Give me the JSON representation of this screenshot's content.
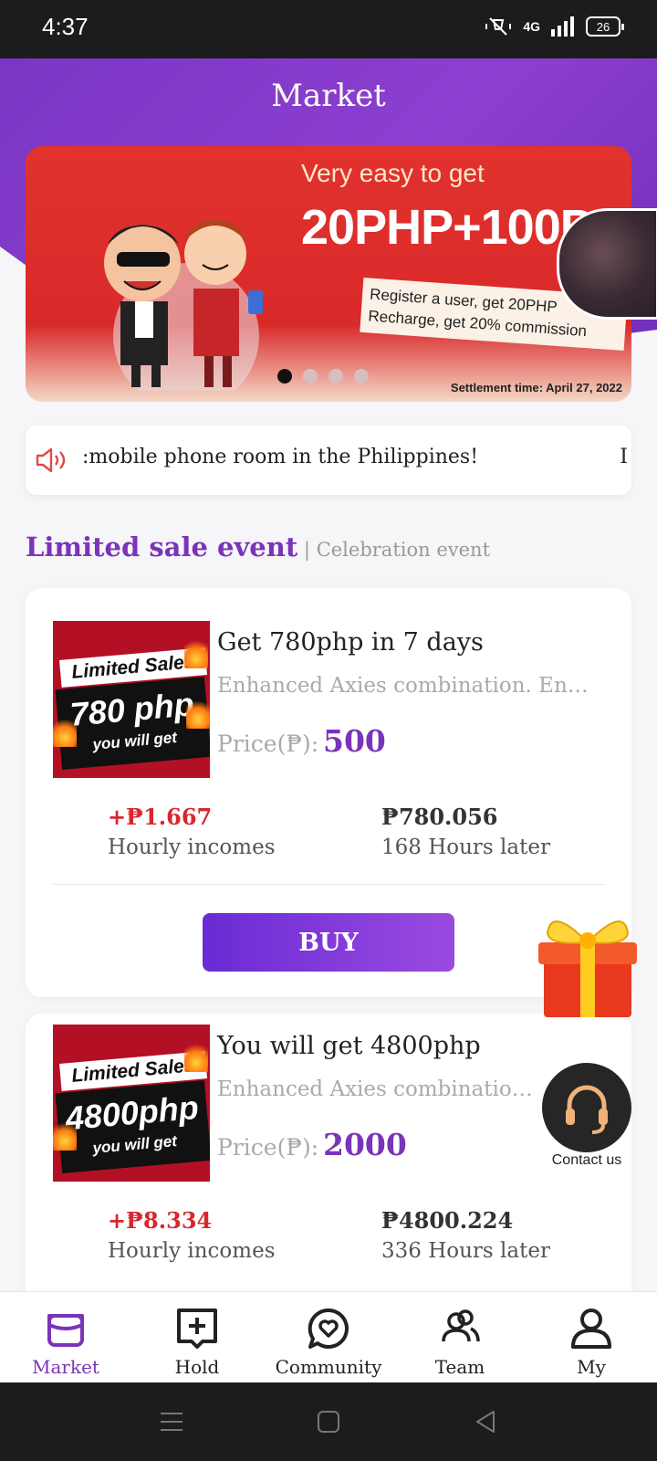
{
  "status_bar": {
    "time": "4:37",
    "network": "4G",
    "battery": "26"
  },
  "header": {
    "title": "Market"
  },
  "banner": {
    "heading": "Very easy to get",
    "amount": "20PHP+100PH",
    "note_line1": "Register a user, get 20PHP",
    "note_line2": "Recharge, get 20% commission",
    "settlement": "Settlement time:  April 27, 2022",
    "dots_total": 4,
    "dots_active": 0
  },
  "notice": {
    "text": ":mobile phone room in the Philippines!",
    "tail": "I"
  },
  "section": {
    "title": "Limited sale event",
    "separator": " | ",
    "subtitle": "Celebration event"
  },
  "products": [
    {
      "thumb_top": "Limited Sales",
      "thumb_num": "780 php",
      "thumb_bottom": "you will get",
      "name": "Get 780php in 7 days",
      "desc": "Enhanced Axies combination. Enh...",
      "price_label": "Price(₱):",
      "price": "500",
      "hourly_value": "+₱1.667",
      "hourly_label": "Hourly incomes",
      "total_value": "₱780.056",
      "total_label": "168 Hours later",
      "buy_label": "BUY"
    },
    {
      "thumb_top": "Limited Sales",
      "thumb_num": "4800php",
      "thumb_bottom": "you will get",
      "name": "You will get 4800php",
      "desc": "Enhanced Axies combination E",
      "price_label": "Price(₱):",
      "price": "2000",
      "hourly_value": "+₱8.334",
      "hourly_label": "Hourly incomes",
      "total_value": "₱4800.224",
      "total_label": "336 Hours later"
    }
  ],
  "contact": {
    "label": "Contact us"
  },
  "tabs": [
    {
      "label": "Market",
      "icon": "market-icon",
      "active": true
    },
    {
      "label": "Hold",
      "icon": "hold-icon",
      "active": false
    },
    {
      "label": "Community",
      "icon": "community-icon",
      "active": false
    },
    {
      "label": "Team",
      "icon": "team-icon",
      "active": false
    },
    {
      "label": "My",
      "icon": "my-icon",
      "active": false
    }
  ],
  "colors": {
    "brand": "#7a34b8",
    "header_gradient_start": "#7a36c4",
    "banner_red": "#e2322e",
    "income_red": "#d7262d"
  }
}
